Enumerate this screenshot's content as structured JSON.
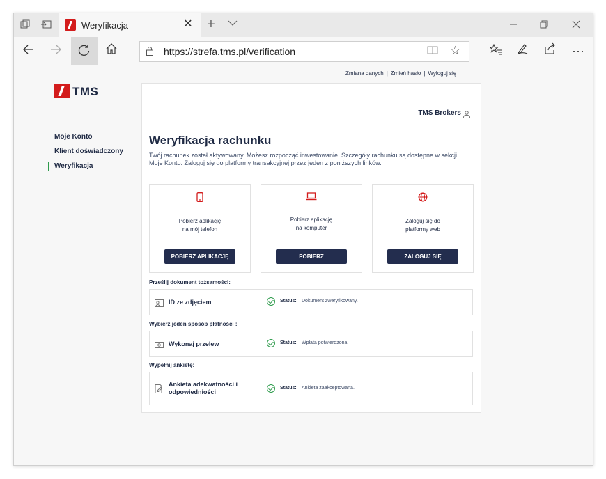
{
  "browser": {
    "tab_title": "Weryfikacja",
    "url": "https://strefa.tms.pl/verification"
  },
  "topnav": {
    "items": [
      "Zmiana danych",
      "Zmień hasło",
      "Wyloguj się"
    ]
  },
  "brand": {
    "name": "TMS"
  },
  "sidebar": {
    "items": [
      {
        "label": "Moje Konto"
      },
      {
        "label": "Klient doświadczony"
      },
      {
        "label": "Weryfikacja"
      }
    ]
  },
  "main": {
    "user_name": "TMS Brokers",
    "title": "Weryfikacja rachunku",
    "desc_part1": "Twój rachunek został aktywowany. Możesz rozpocząć inwestowanie. Szczegóły rachunku są dostępne w sekcji ",
    "desc_link": "Moje Konto",
    "desc_part2": ". Zaloguj się do platformy transakcyjnej przez jeden z poniższych linków.",
    "options": [
      {
        "icon": "phone-icon",
        "line1": "Pobierz aplikację",
        "line2": "na mój telefon",
        "button": "POBIERZ APLIKACJĘ"
      },
      {
        "icon": "laptop-icon",
        "line1": "Pobierz aplikację",
        "line2": "na komputer",
        "button": "POBIERZ"
      },
      {
        "icon": "globe-icon",
        "line1": "Zaloguj się do",
        "line2": "platformy web",
        "button": "ZALOGUJ SIĘ"
      }
    ],
    "sections": [
      {
        "label": "Prześlij dokument tożsamości:",
        "row_title": "ID ze zdjęciem",
        "row_title2": "",
        "status_label": "Status:",
        "status_value": "Dokument zweryfikowany."
      },
      {
        "label": "Wybierz jeden sposób płatności :",
        "row_title": "Wykonaj przelew",
        "row_title2": "",
        "status_label": "Status:",
        "status_value": "Wpłata potwierdzona."
      },
      {
        "label": "Wypełnij ankietę:",
        "row_title": "Ankieta adekwatności i",
        "row_title2": "odpowiedniości",
        "status_label": "Status:",
        "status_value": "Ankieta zaakceptowana."
      }
    ]
  },
  "colors": {
    "accent_red": "#d31c1c",
    "navy": "#232d4e",
    "success_green": "#2e9b4c"
  }
}
